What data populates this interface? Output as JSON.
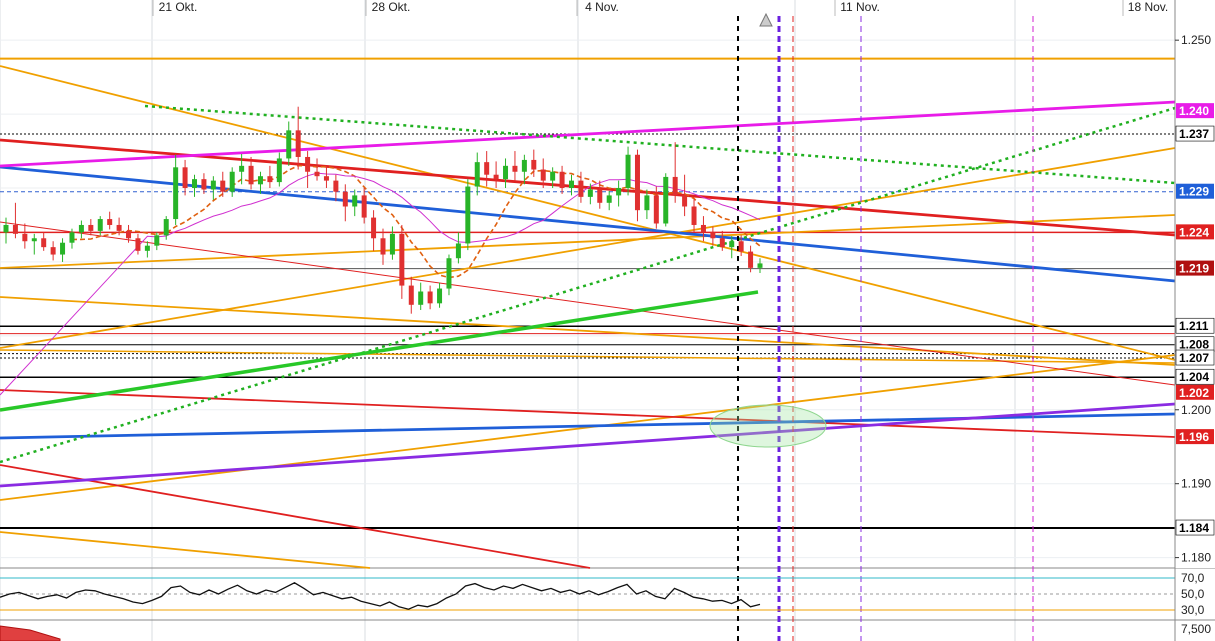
{
  "chart_data": [
    {
      "type": "candlestick",
      "x_ticks": [
        "21 Okt.",
        "28 Okt.",
        "4 Nov.",
        "11 Nov.",
        "18 Nov."
      ],
      "y_ticks": [
        "1.250",
        "1.200",
        "1.190",
        "1.180"
      ],
      "ylim": [
        1.179,
        1.253
      ],
      "price_tags": [
        {
          "text": "1.240",
          "value": 1.2404,
          "bg": "#e81ce8",
          "fg": "#ffffff"
        },
        {
          "text": "1.237",
          "value": 1.2373,
          "bg": "#ffffff",
          "fg": "#000000"
        },
        {
          "text": "1.229",
          "value": 1.2295,
          "bg": "#1f5fd8",
          "fg": "#ffffff"
        },
        {
          "text": "1.224",
          "value": 1.224,
          "bg": "#e02020",
          "fg": "#ffffff"
        },
        {
          "text": "1.219",
          "value": 1.2191,
          "bg": "#b01010",
          "fg": "#ffffff"
        },
        {
          "text": "1.211",
          "value": 1.2113,
          "bg": "#ffffff",
          "fg": "#000000"
        },
        {
          "text": "1.208",
          "value": 1.2088,
          "bg": "#ffffff",
          "fg": "#000000"
        },
        {
          "text": "1.207",
          "value": 1.207,
          "bg": "#ffffff",
          "fg": "#000000"
        },
        {
          "text": "1.204",
          "value": 1.2044,
          "bg": "#ffffff",
          "fg": "#000000"
        },
        {
          "text": "1.202",
          "value": 1.2023,
          "bg": "#e02020",
          "fg": "#ffffff"
        },
        {
          "text": "1.196",
          "value": 1.1963,
          "bg": "#e02020",
          "fg": "#ffffff"
        },
        {
          "text": "1.184",
          "value": 1.184,
          "bg": "#ffffff",
          "fg": "#000000"
        }
      ],
      "candles": [
        [
          1.224,
          1.226,
          1.2225,
          1.225
        ],
        [
          1.225,
          1.228,
          1.2232,
          1.2238
        ],
        [
          1.2238,
          1.2252,
          1.2218,
          1.2228
        ],
        [
          1.2228,
          1.2238,
          1.221,
          1.2232
        ],
        [
          1.2232,
          1.224,
          1.2215,
          1.222
        ],
        [
          1.222,
          1.2228,
          1.2202,
          1.221
        ],
        [
          1.221,
          1.2232,
          1.22,
          1.2226
        ],
        [
          1.2226,
          1.2245,
          1.2218,
          1.224
        ],
        [
          1.224,
          1.2256,
          1.2232,
          1.225
        ],
        [
          1.225,
          1.2258,
          1.2236,
          1.2242
        ],
        [
          1.2242,
          1.2262,
          1.2236,
          1.2258
        ],
        [
          1.2258,
          1.2268,
          1.2244,
          1.225
        ],
        [
          1.225,
          1.226,
          1.2236,
          1.2242
        ],
        [
          1.2242,
          1.225,
          1.2226,
          1.2232
        ],
        [
          1.2232,
          1.2238,
          1.221,
          1.2215
        ],
        [
          1.2215,
          1.2228,
          1.2206,
          1.2222
        ],
        [
          1.2222,
          1.224,
          1.2216,
          1.2236
        ],
        [
          1.2236,
          1.2262,
          1.223,
          1.2258
        ],
        [
          1.2258,
          1.2345,
          1.225,
          1.2328
        ],
        [
          1.2328,
          1.2338,
          1.229,
          1.23
        ],
        [
          1.23,
          1.2318,
          1.2288,
          1.2312
        ],
        [
          1.2312,
          1.232,
          1.2292,
          1.2298
        ],
        [
          1.2298,
          1.2316,
          1.2284,
          1.231
        ],
        [
          1.231,
          1.2322,
          1.2288,
          1.2295
        ],
        [
          1.2295,
          1.2328,
          1.2288,
          1.2322
        ],
        [
          1.2322,
          1.2346,
          1.2305,
          1.233
        ],
        [
          1.233,
          1.2342,
          1.2298,
          1.2305
        ],
        [
          1.2305,
          1.2322,
          1.2292,
          1.2316
        ],
        [
          1.2316,
          1.233,
          1.23,
          1.2308
        ],
        [
          1.2308,
          1.2348,
          1.2302,
          1.234
        ],
        [
          1.234,
          1.239,
          1.233,
          1.2378
        ],
        [
          1.2378,
          1.241,
          1.2325,
          1.2342
        ],
        [
          1.2342,
          1.235,
          1.23,
          1.2322
        ],
        [
          1.2322,
          1.234,
          1.231,
          1.2316
        ],
        [
          1.2316,
          1.233,
          1.23,
          1.231
        ],
        [
          1.231,
          1.2318,
          1.2282,
          1.2295
        ],
        [
          1.2295,
          1.2305,
          1.2255,
          1.2275
        ],
        [
          1.2275,
          1.2298,
          1.2262,
          1.229
        ],
        [
          1.229,
          1.23,
          1.2252,
          1.226
        ],
        [
          1.226,
          1.227,
          1.2215,
          1.2232
        ],
        [
          1.2232,
          1.2245,
          1.2196,
          1.221
        ],
        [
          1.221,
          1.2248,
          1.2203,
          1.2238
        ],
        [
          1.2238,
          1.225,
          1.215,
          1.2168
        ],
        [
          1.2168,
          1.218,
          1.213,
          1.2142
        ],
        [
          1.2142,
          1.2172,
          1.2135,
          1.216
        ],
        [
          1.216,
          1.2168,
          1.2136,
          1.2144
        ],
        [
          1.2144,
          1.2172,
          1.2138,
          1.2164
        ],
        [
          1.2164,
          1.221,
          1.2155,
          1.2205
        ],
        [
          1.2205,
          1.224,
          1.2198,
          1.2225
        ],
        [
          1.2225,
          1.2312,
          1.2216,
          1.2302
        ],
        [
          1.2302,
          1.2348,
          1.229,
          1.2335
        ],
        [
          1.2335,
          1.235,
          1.2302,
          1.2318
        ],
        [
          1.2318,
          1.2336,
          1.23,
          1.2312
        ],
        [
          1.2312,
          1.234,
          1.23,
          1.233
        ],
        [
          1.233,
          1.235,
          1.231,
          1.2322
        ],
        [
          1.2322,
          1.2345,
          1.2305,
          1.2338
        ],
        [
          1.2338,
          1.2352,
          1.2315,
          1.2325
        ],
        [
          1.2325,
          1.234,
          1.23,
          1.231
        ],
        [
          1.231,
          1.2328,
          1.23,
          1.2322
        ],
        [
          1.2322,
          1.233,
          1.2292,
          1.23
        ],
        [
          1.23,
          1.2318,
          1.229,
          1.231
        ],
        [
          1.231,
          1.2322,
          1.228,
          1.2288
        ],
        [
          1.2288,
          1.2306,
          1.2278,
          1.2298
        ],
        [
          1.2298,
          1.231,
          1.2272,
          1.228
        ],
        [
          1.228,
          1.2296,
          1.227,
          1.229
        ],
        [
          1.229,
          1.231,
          1.2275,
          1.23
        ],
        [
          1.23,
          1.2356,
          1.229,
          1.2345
        ],
        [
          1.2345,
          1.2352,
          1.2255,
          1.227
        ],
        [
          1.227,
          1.2298,
          1.2258,
          1.229
        ],
        [
          1.229,
          1.2302,
          1.2245,
          1.2252
        ],
        [
          1.2252,
          1.232,
          1.2248,
          1.2315
        ],
        [
          1.2315,
          1.2362,
          1.228,
          1.229
        ],
        [
          1.229,
          1.2318,
          1.2262,
          1.2275
        ],
        [
          1.2275,
          1.2285,
          1.224,
          1.225
        ],
        [
          1.225,
          1.2262,
          1.2228,
          1.224
        ],
        [
          1.224,
          1.2248,
          1.2222,
          1.2232
        ],
        [
          1.2232,
          1.2242,
          1.2215,
          1.222
        ],
        [
          1.222,
          1.2235,
          1.2205,
          1.2228
        ],
        [
          1.2228,
          1.2236,
          1.2208,
          1.2214
        ],
        [
          1.2214,
          1.2222,
          1.2186,
          1.2192
        ],
        [
          1.2192,
          1.2205,
          1.2185,
          1.2198
        ]
      ],
      "rsi": {
        "levels": [
          "70,0",
          "50,0",
          "30,0"
        ],
        "values": [
          46,
          50,
          52,
          48,
          44,
          47,
          49,
          45,
          52,
          55,
          54,
          50,
          47,
          44,
          40,
          38,
          42,
          47,
          58,
          60,
          52,
          49,
          55,
          50,
          56,
          61,
          54,
          50,
          55,
          52,
          58,
          64,
          57,
          49,
          52,
          48,
          44,
          46,
          41,
          38,
          35,
          40,
          34,
          31,
          36,
          34,
          38,
          45,
          50,
          60,
          63,
          58,
          55,
          60,
          57,
          62,
          58,
          54,
          57,
          52,
          55,
          50,
          54,
          49,
          53,
          58,
          62,
          50,
          54,
          47,
          44,
          57,
          52,
          46,
          44,
          41,
          42,
          38,
          43,
          34,
          37
        ]
      }
    }
  ]
}
